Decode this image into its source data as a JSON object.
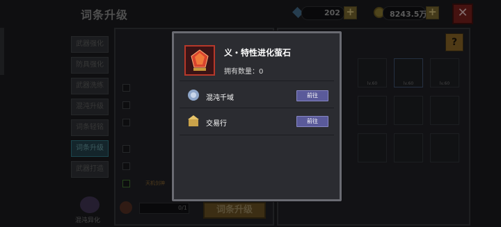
{
  "header": {
    "title": "词条升级",
    "gems": "202",
    "gold": "8243.5万",
    "close_glyph": "✕",
    "plus_glyph": "+"
  },
  "side_menu": [
    {
      "label": "武器强化",
      "active": false
    },
    {
      "label": "防具强化",
      "active": false
    },
    {
      "label": "武器洗练",
      "active": false
    },
    {
      "label": "混沌升级",
      "active": false
    },
    {
      "label": "词条轻铭",
      "active": false
    },
    {
      "label": "词条升级",
      "active": true
    },
    {
      "label": "武器打造",
      "active": false
    }
  ],
  "side_bottom": {
    "label": "混沌异化"
  },
  "list_rows": [
    {
      "tag": ""
    },
    {
      "tag": ""
    },
    {
      "tag": ""
    },
    {
      "tag": ""
    },
    {
      "tag": ""
    },
    {
      "tag": "天机剑神"
    }
  ],
  "bottom_bar": {
    "progress": "0/1",
    "action_label": "词条升级"
  },
  "help_glyph": "?",
  "slots_level": "lv.60",
  "modal": {
    "item_name": "义・特性进化萤石",
    "owned_label": "拥有数量：",
    "owned_count": "0",
    "sources": [
      {
        "name": "混沌千域",
        "button": "前往",
        "icon": "chaos-domain-icon"
      },
      {
        "name": "交易行",
        "button": "前往",
        "icon": "trading-house-icon"
      }
    ]
  },
  "colors": {
    "accent": "#5a5a9a",
    "item_border": "#b7382a",
    "modal_bg": "#2b2c31"
  }
}
